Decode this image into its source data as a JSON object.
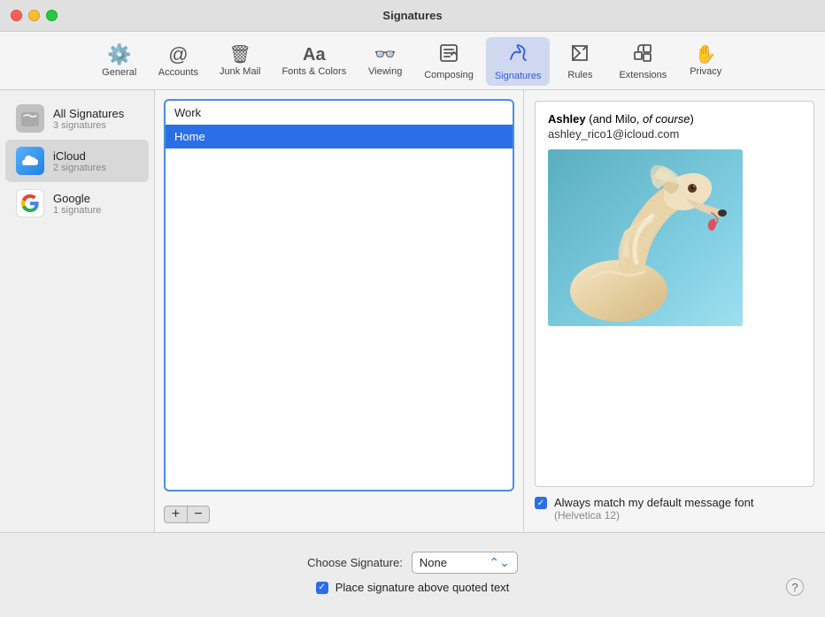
{
  "window": {
    "title": "Signatures"
  },
  "toolbar": {
    "items": [
      {
        "id": "general",
        "label": "General",
        "icon": "⚙️",
        "active": false
      },
      {
        "id": "accounts",
        "label": "Accounts",
        "icon": "✉",
        "active": false
      },
      {
        "id": "junk-mail",
        "label": "Junk Mail",
        "icon": "🗑",
        "active": false
      },
      {
        "id": "fonts-colors",
        "label": "Fonts & Colors",
        "icon": "Aa",
        "active": false
      },
      {
        "id": "viewing",
        "label": "Viewing",
        "icon": "👓",
        "active": false
      },
      {
        "id": "composing",
        "label": "Composing",
        "icon": "✏",
        "active": false
      },
      {
        "id": "signatures",
        "label": "Signatures",
        "icon": "✍",
        "active": true
      },
      {
        "id": "rules",
        "label": "Rules",
        "icon": "📥",
        "active": false
      },
      {
        "id": "extensions",
        "label": "Extensions",
        "icon": "🔧",
        "active": false
      },
      {
        "id": "privacy",
        "label": "Privacy",
        "icon": "✋",
        "active": false
      }
    ]
  },
  "sidebar": {
    "items": [
      {
        "id": "all-signatures",
        "name": "All Signatures",
        "count": "3 signatures",
        "type": "all"
      },
      {
        "id": "icloud",
        "name": "iCloud",
        "count": "2 signatures",
        "type": "icloud"
      },
      {
        "id": "google",
        "name": "Google",
        "count": "1 signature",
        "type": "google"
      }
    ],
    "selected": "icloud"
  },
  "signatures_list": {
    "items": [
      {
        "id": "work",
        "label": "Work",
        "selected": false
      },
      {
        "id": "home",
        "label": "Home",
        "selected": true
      }
    ],
    "add_button": "+",
    "remove_button": "−"
  },
  "preview": {
    "name_bold": "Ashley",
    "name_rest": " (and Milo, ",
    "name_italic": "of course",
    "name_close": ")",
    "email": "ashley_rico1@icloud.com",
    "font_match_label": "Always match my default message font",
    "font_hint": "(Helvetica 12)"
  },
  "bottom": {
    "choose_signature_label": "Choose Signature:",
    "choose_signature_value": "None",
    "place_signature_label": "Place signature above quoted text",
    "help_label": "?"
  }
}
